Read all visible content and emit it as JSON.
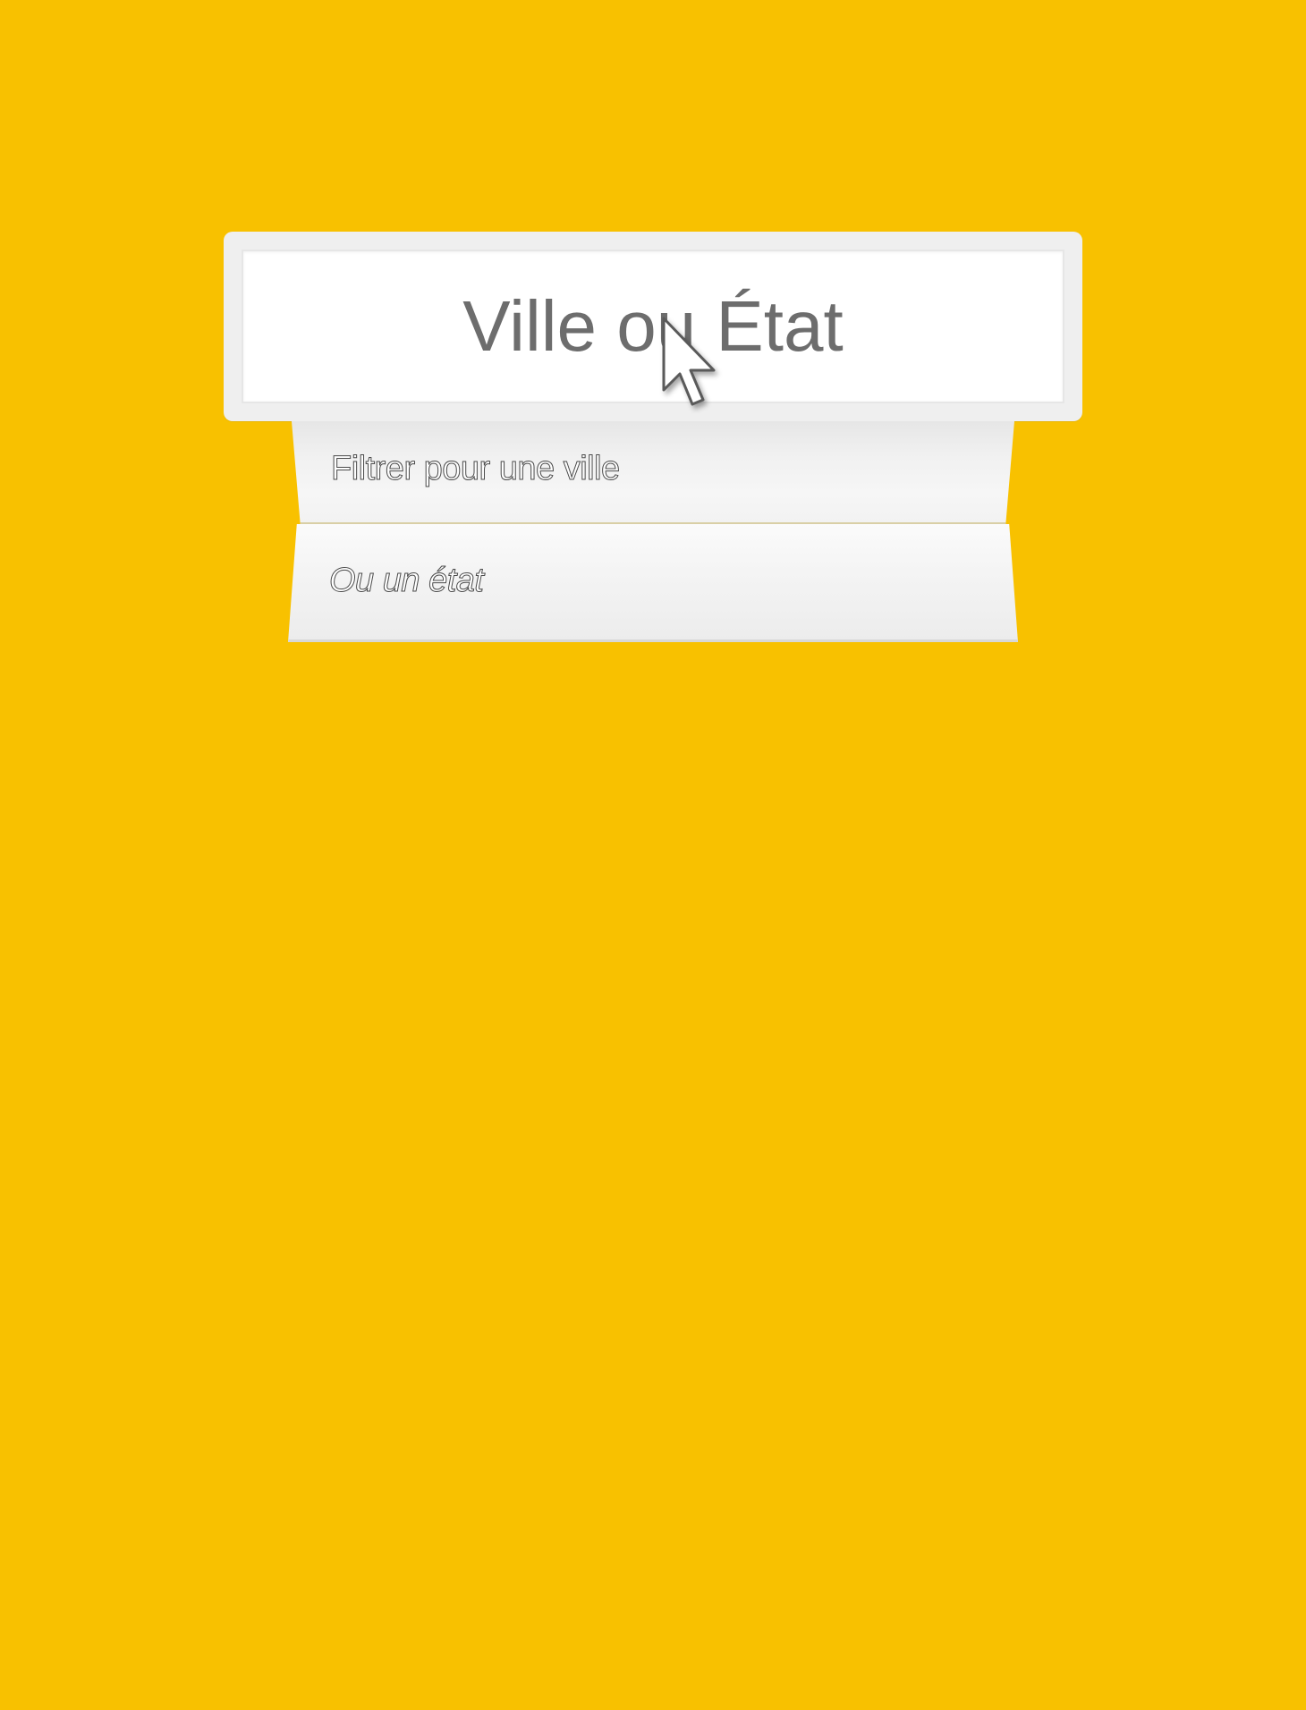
{
  "search": {
    "placeholder": "Ville ou État"
  },
  "dropdown": {
    "items": [
      {
        "label": "Filtrer pour une ville"
      },
      {
        "label": "Ou un état"
      }
    ]
  },
  "colors": {
    "background": "#f8c100",
    "card": "#efefef",
    "input": "#ffffff",
    "placeholder_text": "#6d6d6d"
  },
  "icons": {
    "cursor": "mouse-pointer-icon"
  }
}
